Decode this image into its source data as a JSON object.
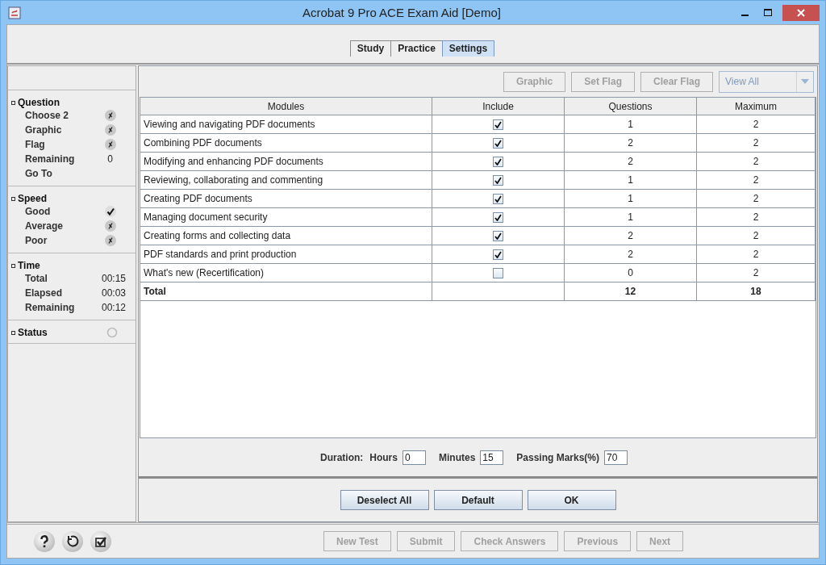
{
  "window": {
    "title": "Acrobat 9 Pro ACE Exam Aid [Demo]"
  },
  "tabs": [
    {
      "label": "Study",
      "selected": false
    },
    {
      "label": "Practice",
      "selected": false
    },
    {
      "label": "Settings",
      "selected": true
    }
  ],
  "sidebar": {
    "sections": [
      {
        "title": "Question",
        "items": [
          {
            "kind": "flag",
            "label": "Choose 2",
            "checked": false
          },
          {
            "kind": "flag",
            "label": "Graphic",
            "checked": false
          },
          {
            "kind": "flag",
            "label": "Flag",
            "checked": false
          },
          {
            "kind": "value",
            "label": "Remaining",
            "value": "0"
          },
          {
            "kind": "link",
            "label": "Go To"
          }
        ]
      },
      {
        "title": "Speed",
        "items": [
          {
            "kind": "flag",
            "label": "Good",
            "checked": true
          },
          {
            "kind": "flag",
            "label": "Average",
            "checked": false
          },
          {
            "kind": "flag",
            "label": "Poor",
            "checked": false
          }
        ]
      },
      {
        "title": "Time",
        "items": [
          {
            "kind": "value",
            "label": "Total",
            "value": "00:15"
          },
          {
            "kind": "value",
            "label": "Elapsed",
            "value": "00:03"
          },
          {
            "kind": "value",
            "label": "Remaining",
            "value": "00:12"
          }
        ]
      },
      {
        "title": "Status",
        "lit": false
      }
    ]
  },
  "toolbar": {
    "buttons": [
      {
        "label": "Graphic",
        "disabled": true
      },
      {
        "label": "Set Flag",
        "disabled": true
      },
      {
        "label": "Clear Flag",
        "disabled": true
      }
    ],
    "view_select": {
      "value": "View All",
      "disabled": true
    }
  },
  "table": {
    "columns": [
      "Modules",
      "Include",
      "Questions",
      "Maximum"
    ],
    "rows": [
      {
        "module": "Viewing and navigating PDF documents",
        "include": true,
        "questions": "1",
        "maximum": "2"
      },
      {
        "module": "Combining PDF documents",
        "include": true,
        "questions": "2",
        "maximum": "2"
      },
      {
        "module": "Modifying and enhancing PDF documents",
        "include": true,
        "questions": "2",
        "maximum": "2"
      },
      {
        "module": "Reviewing, collaborating and commenting",
        "include": true,
        "questions": "1",
        "maximum": "2"
      },
      {
        "module": "Creating PDF documents",
        "include": true,
        "questions": "1",
        "maximum": "2"
      },
      {
        "module": "Managing document security",
        "include": true,
        "questions": "1",
        "maximum": "2"
      },
      {
        "module": "Creating forms and collecting data",
        "include": true,
        "questions": "2",
        "maximum": "2"
      },
      {
        "module": "PDF standards and print production",
        "include": true,
        "questions": "2",
        "maximum": "2"
      },
      {
        "module": "What's new (Recertification)",
        "include": false,
        "questions": "0",
        "maximum": "2"
      }
    ],
    "total": {
      "label": "Total",
      "questions": "12",
      "maximum": "18"
    }
  },
  "duration": {
    "label": "Duration:",
    "fields": [
      {
        "label": "Hours",
        "value": "0"
      },
      {
        "label": "Minutes",
        "value": "15"
      },
      {
        "label": "Passing Marks(%)",
        "value": "70"
      }
    ]
  },
  "actions": [
    {
      "label": "Deselect All",
      "disabled": false
    },
    {
      "label": "Default",
      "disabled": false
    },
    {
      "label": "OK",
      "disabled": false
    }
  ],
  "footer": {
    "buttons": [
      {
        "label": "New Test",
        "disabled": true
      },
      {
        "label": "Submit",
        "disabled": true
      },
      {
        "label": "Check Answers",
        "disabled": true
      },
      {
        "label": "Previous",
        "disabled": true
      },
      {
        "label": "Next",
        "disabled": true
      }
    ]
  }
}
